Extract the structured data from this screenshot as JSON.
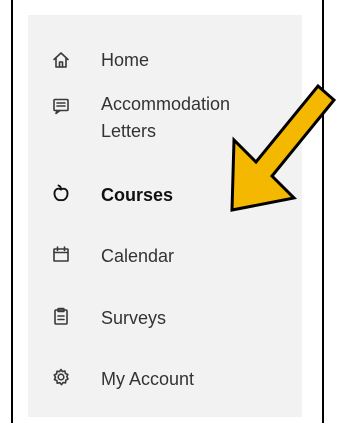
{
  "sidebar": {
    "items": [
      {
        "label": "Home",
        "icon": "home-icon",
        "active": false
      },
      {
        "label": "Accommodation\nLetters",
        "icon": "letter-icon",
        "active": false
      },
      {
        "label": "Courses",
        "icon": "apple-icon",
        "active": true
      },
      {
        "label": "Calendar",
        "icon": "calendar-icon",
        "active": false
      },
      {
        "label": "Surveys",
        "icon": "clipboard-icon",
        "active": false
      },
      {
        "label": "My Account",
        "icon": "gear-icon",
        "active": false
      }
    ]
  },
  "annotation": {
    "arrow_color": "#F5B800",
    "arrow_outline_color": "#000000",
    "points_to": "Courses"
  }
}
